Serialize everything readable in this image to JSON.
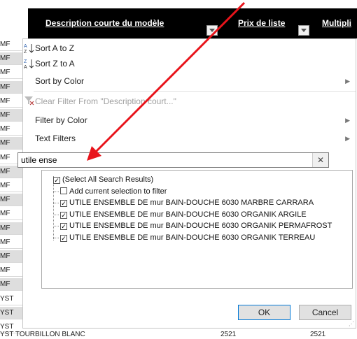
{
  "header": {
    "col1_label": "Description courte du modèle",
    "col2_label": "Prix de liste",
    "col3_label": "Multipli"
  },
  "left_strip": [
    "MF",
    "MF",
    "MF",
    "MF",
    "MF",
    "MF",
    "MF",
    "MF",
    "MF",
    "MF",
    "MF",
    "MF",
    "MF",
    "MF",
    "MF",
    "MF",
    "MF",
    "MF",
    "YST",
    "YST",
    "YST"
  ],
  "bottom_row": {
    "text": "YST TOURBILLON BLANC",
    "v1": "2521",
    "v2": "2521"
  },
  "menu": {
    "sort_az": "Sort A to Z",
    "sort_za": "Sort Z to A",
    "sort_color": "Sort by Color",
    "clear_filter": "Clear Filter From \"Description court...\"",
    "filter_color": "Filter by Color",
    "text_filters": "Text Filters"
  },
  "search": {
    "value": "utile ense"
  },
  "results": [
    {
      "label": "(Select All Search Results)",
      "checked": true
    },
    {
      "label": "Add current selection to filter",
      "checked": false
    },
    {
      "label": "UTILE ENSEMBLE DE mur BAIN-DOUCHE 6030 MARBRE CARRARA",
      "checked": true
    },
    {
      "label": "UTILE ENSEMBLE DE mur BAIN-DOUCHE 6030 ORGANIK ARGILE",
      "checked": true
    },
    {
      "label": "UTILE ENSEMBLE DE mur BAIN-DOUCHE 6030 ORGANIK PERMAFROST",
      "checked": true
    },
    {
      "label": "UTILE ENSEMBLE DE mur BAIN-DOUCHE 6030 ORGANIK TERREAU",
      "checked": true
    }
  ],
  "buttons": {
    "ok": "OK",
    "cancel": "Cancel"
  },
  "icons": {
    "sort_az": "sort-ascending-icon",
    "sort_za": "sort-descending-icon",
    "clear": "clear-filter-icon",
    "close": "close-icon"
  },
  "colors": {
    "annotation_arrow": "#e8141b",
    "header_bg": "#000000"
  }
}
